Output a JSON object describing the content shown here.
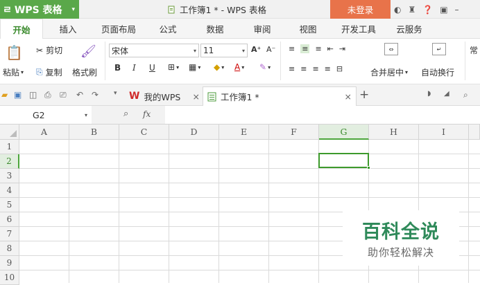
{
  "app": {
    "name": "WPS 表格",
    "logo": "ㄹ",
    "dropdown": "▾"
  },
  "window": {
    "doc_title": "工作簿1 * - WPS 表格",
    "login_label": "未登录"
  },
  "menu": {
    "tabs": [
      "开始",
      "插入",
      "页面布局",
      "公式",
      "数据",
      "审阅",
      "视图",
      "开发工具",
      "云服务"
    ],
    "active": "开始"
  },
  "ribbon": {
    "paste": "粘贴",
    "cut": "剪切",
    "copy": "复制",
    "format_painter": "格式刷",
    "font_name": "宋体",
    "font_size": "11",
    "bold": "B",
    "italic": "I",
    "underline": "U",
    "grow_font": "A⁺",
    "shrink_font": "A⁻",
    "merge_center": "合并居中",
    "auto_wrap": "自动换行",
    "number_format": "常"
  },
  "doc_tabs": [
    {
      "label": "我的WPS",
      "close": "×"
    },
    {
      "label": "工作簿1 *",
      "close": "×"
    }
  ],
  "new_tab": "+",
  "formula_bar": {
    "cell_ref": "G2",
    "zoom_icon": "⌕",
    "fx": "fx",
    "value": ""
  },
  "sheet": {
    "columns": [
      "A",
      "B",
      "C",
      "D",
      "E",
      "F",
      "G",
      "H",
      "I"
    ],
    "rows": [
      "1",
      "2",
      "3",
      "4",
      "5",
      "6",
      "7",
      "8",
      "9",
      "10"
    ],
    "selected_col": "G",
    "selected_row": "2"
  },
  "watermark": {
    "title": "百科全说",
    "subtitle": "助你轻松解决"
  },
  "colors": {
    "accent": "#5aa84a",
    "login": "#e8734a",
    "watermark": "#2f8a5a"
  }
}
